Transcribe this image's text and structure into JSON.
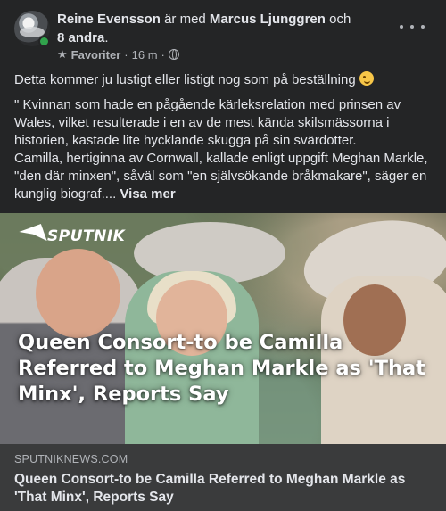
{
  "post": {
    "author": "Reine Evensson",
    "with_word": "är med",
    "tagged": "Marcus Ljunggren",
    "and_word": "och",
    "others": "8 andra",
    "period": ".",
    "audience": "Favoriter",
    "time": "16 m",
    "separator": "·",
    "status": "online",
    "intro_text": "Detta kommer ju lustigt eller listigt nog som på beställning",
    "emoji": "winking-face",
    "body_line1": "\" Kvinnan som hade en pågående kärleksrelation med prinsen av Wales, vilket resulterade i en av de mest kända skilsmässorna i historien, kastade lite hycklande skugga på sin svärdotter.",
    "body_line2": "Camilla, hertiginna av Cornwall, kallade enligt uppgift Meghan Markle, \"den där minxen\", såväl som \"en självsökande bråkmakare\", säger en kunglig biograf....",
    "see_more": "Visa mer"
  },
  "image": {
    "brand": "SPUTNIK",
    "headline": "Queen Consort-to be Camilla Referred to Meghan Markle as 'That Minx', Reports Say"
  },
  "link": {
    "domain": "SPUTNIKNEWS.COM",
    "title": "Queen Consort-to be Camilla Referred to Meghan Markle as 'That Minx', Reports Say"
  },
  "colors": {
    "background": "#242526",
    "card": "#3a3b3c",
    "text": "#e4e6eb",
    "secondary_text": "#b0b3b8",
    "online": "#31a24c"
  }
}
